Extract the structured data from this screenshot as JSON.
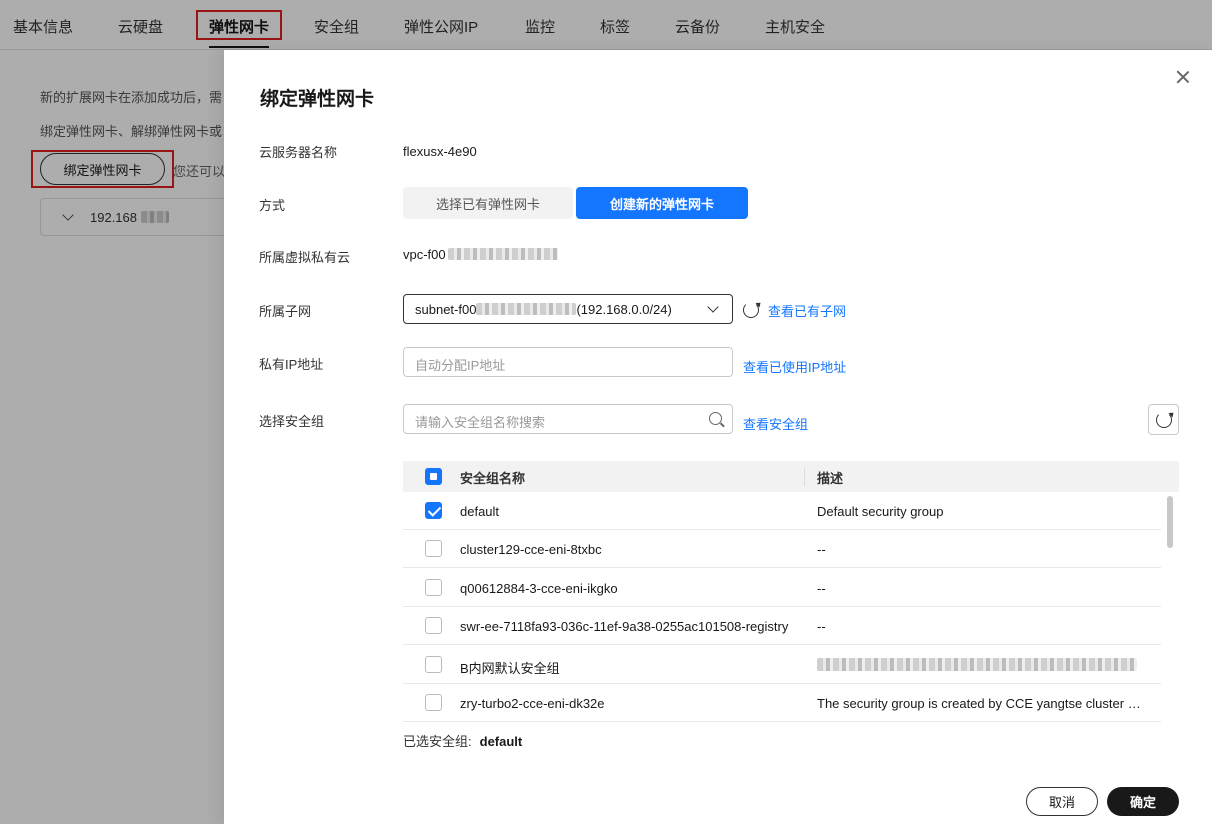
{
  "tabs": [
    {
      "label": "基本信息"
    },
    {
      "label": "云硬盘"
    },
    {
      "label": "弹性网卡"
    },
    {
      "label": "安全组"
    },
    {
      "label": "弹性公网IP"
    },
    {
      "label": "监控"
    },
    {
      "label": "标签"
    },
    {
      "label": "云备份"
    },
    {
      "label": "主机安全"
    }
  ],
  "background": {
    "notice_line1": "新的扩展网卡在添加成功后，需",
    "notice_line2": "绑定弹性网卡、解绑弹性网卡或",
    "bind_button": "绑定弹性网卡",
    "tail_text": "您还可以",
    "nic_ip": "192.168"
  },
  "drawer": {
    "title": "绑定弹性网卡",
    "server_name_label": "云服务器名称",
    "server_name": "flexusx-4e90",
    "mode_label": "方式",
    "mode_options": [
      "选择已有弹性网卡",
      "创建新的弹性网卡"
    ],
    "mode_selected": 1,
    "vpc_label": "所属虚拟私有云",
    "vpc_value": "vpc-f00",
    "subnet_label": "所属子网",
    "subnet_prefix": "subnet-f00",
    "subnet_cidr": "(192.168.0.0/24)",
    "view_subnet_link": "查看已有子网",
    "ip_label": "私有IP地址",
    "ip_placeholder": "自动分配IP地址",
    "view_ip_link": "查看已使用IP地址",
    "sg_label": "选择安全组",
    "sg_placeholder": "请输入安全组名称搜索",
    "view_sg_link": "查看安全组",
    "table": {
      "col_name": "安全组名称",
      "col_desc": "描述",
      "rows": [
        {
          "name": "default",
          "desc": "Default security group",
          "checked": true
        },
        {
          "name": "cluster129-cce-eni-8txbc",
          "desc": "--",
          "checked": false
        },
        {
          "name": "q00612884-3-cce-eni-ikgko",
          "desc": "--",
          "checked": false
        },
        {
          "name": "swr-ee-7118fa93-036c-11ef-9a38-0255ac101508-registry",
          "desc": "--",
          "checked": false
        },
        {
          "name": "B内网默认安全组",
          "desc": "",
          "checked": false
        },
        {
          "name": "zry-turbo2-cce-eni-dk32e",
          "desc": "The security group is created by CCE yangtse cluster …",
          "checked": false
        }
      ]
    },
    "selected_label": "已选安全组:",
    "selected_value": "default",
    "cancel_button": "取消",
    "ok_button": "确定"
  },
  "colors": {
    "primary": "#1476ff",
    "highlight_box": "#e02020",
    "dark_button": "#191919"
  }
}
